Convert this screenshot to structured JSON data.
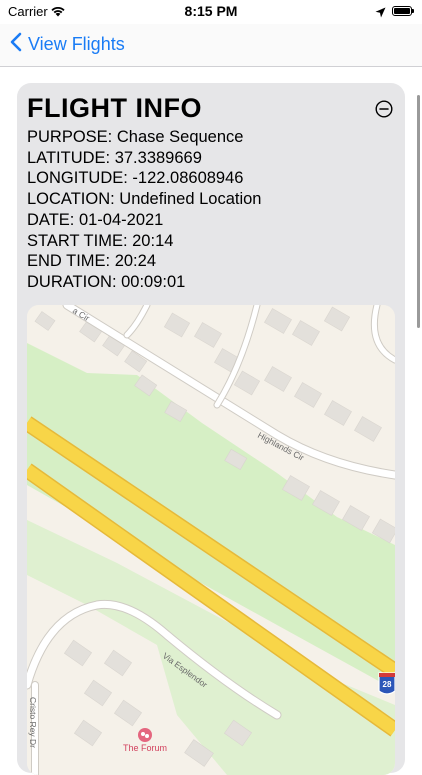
{
  "status_bar": {
    "carrier": "Carrier",
    "time": "8:15 PM"
  },
  "nav": {
    "back_label": "View Flights"
  },
  "flight_info": {
    "title": "FLIGHT INFO",
    "purpose": "PURPOSE: Chase Sequence",
    "latitude": "LATITUDE: 37.3389669",
    "longitude": "LONGITUDE: -122.08608946",
    "location": "LOCATION: Undefined Location",
    "date": "DATE: 01-04-2021",
    "start_time": "START TIME: 20:14",
    "end_time": "END TIME: 20:24",
    "duration": "DURATION: 00:09:01"
  },
  "map": {
    "road_label_top": "a Cir",
    "road_label_highlands": "Highlands Cir",
    "road_label_esplendor": "Via Esplendor",
    "road_label_cristo": "Cristo Rey Dr",
    "highway_shield": "28",
    "poi_label": "The Forum",
    "colors": {
      "land": "#f5f1e9",
      "park": "#d6efc5",
      "highway": "#f8d548",
      "highway_edge": "#e6b93a",
      "building": "#e3e0db"
    }
  },
  "icons": {
    "back": "chevron-left-icon",
    "collapse": "minus-circle-icon",
    "wifi": "wifi-icon",
    "location": "location-arrow-icon",
    "battery": "battery-icon",
    "poi": "theater-icon"
  }
}
